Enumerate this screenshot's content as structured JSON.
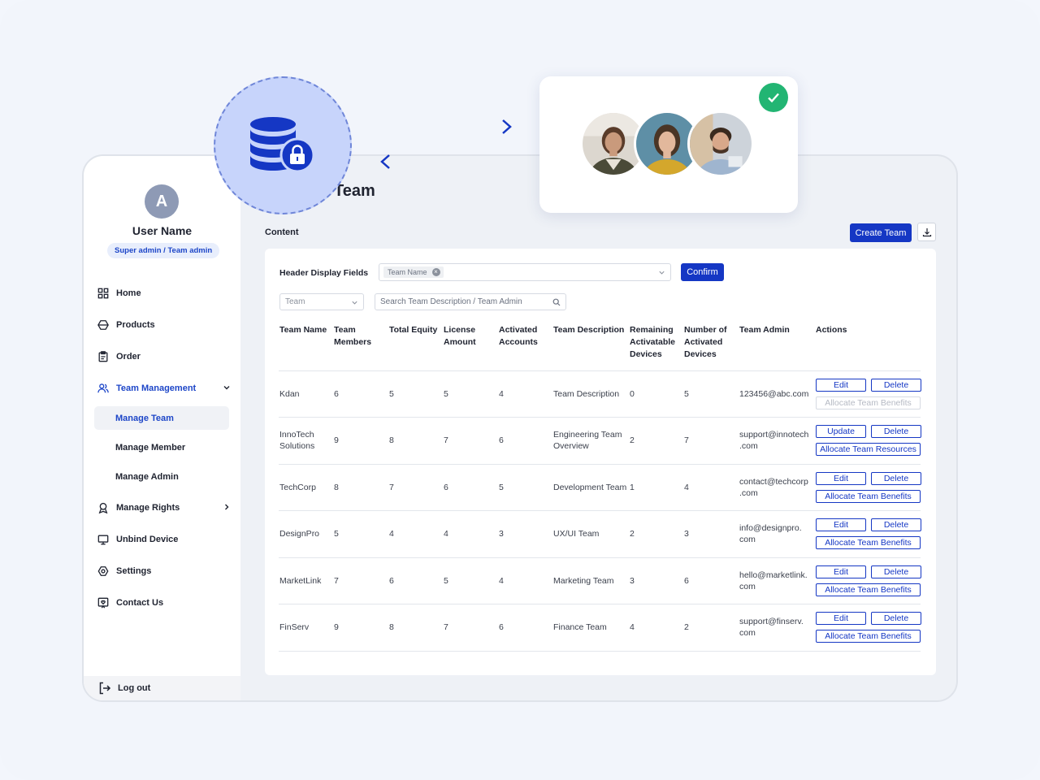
{
  "user": {
    "initial": "A",
    "name": "User Name",
    "role": "Super admin / Team admin"
  },
  "nav": {
    "home": "Home",
    "products": "Products",
    "order": "Order",
    "team_management": "Team Management",
    "manage_team": "Manage Team",
    "manage_member": "Manage Member",
    "manage_admin": "Manage Admin",
    "manage_rights": "Manage Rights",
    "unbind_device": "Unbind Device",
    "settings": "Settings",
    "contact_us": "Contact Us",
    "logout": "Log out"
  },
  "page": {
    "title": "Team",
    "section": "Content",
    "create_button": "Create Team"
  },
  "filters": {
    "header_display_label": "Header Display Fields",
    "selected_tag": "Team Name",
    "confirm": "Confirm",
    "team_select_value": "Team",
    "search_placeholder": "Search Team Description / Team Admin"
  },
  "table": {
    "headers": {
      "name": "Team Name",
      "members": "Team Members",
      "equity": "Total Equity",
      "license": "License Amount",
      "activated": "Activated Accounts",
      "desc": "Team Description",
      "remaining": "Remaining Activatable Devices",
      "num_activated": "Number of Activated Devices",
      "admin": "Team Admin",
      "actions": "Actions"
    },
    "rows": [
      {
        "name": "Kdan",
        "members": "6",
        "equity": "5",
        "license": "5",
        "activated": "4",
        "desc": "Team Description",
        "remaining": "0",
        "num_activated": "5",
        "admin": "123456@abc.com",
        "btn1": "Edit",
        "btn2": "Delete",
        "btn3": "Allocate Team Benefits"
      },
      {
        "name": "InnoTech Solutions",
        "members": "9",
        "equity": "8",
        "license": "7",
        "activated": "6",
        "desc": "Engineering Team Overview",
        "remaining": "2",
        "num_activated": "7",
        "admin": "support@innotech .com",
        "btn1": "Update",
        "btn2": "Delete",
        "btn3": "Allocate Team Resources"
      },
      {
        "name": "TechCorp",
        "members": "8",
        "equity": "7",
        "license": "6",
        "activated": "5",
        "desc": "Development Team",
        "remaining": "1",
        "num_activated": "4",
        "admin": "contact@techcorp .com",
        "btn1": "Edit",
        "btn2": "Delete",
        "btn3": "Allocate Team Benefits"
      },
      {
        "name": "DesignPro",
        "members": "5",
        "equity": "4",
        "license": "4",
        "activated": "3",
        "desc": "UX/UI Team",
        "remaining": "2",
        "num_activated": "3",
        "admin": "info@designpro. com",
        "btn1": "Edit",
        "btn2": "Delete",
        "btn3": "Allocate Team Benefits"
      },
      {
        "name": "MarketLink",
        "members": "7",
        "equity": "6",
        "license": "5",
        "activated": "4",
        "desc": "Marketing Team",
        "remaining": "3",
        "num_activated": "6",
        "admin": "hello@marketlink. com",
        "btn1": "Edit",
        "btn2": "Delete",
        "btn3": "Allocate Team Benefits"
      },
      {
        "name": "FinServ",
        "members": "9",
        "equity": "8",
        "license": "7",
        "activated": "6",
        "desc": "Finance Team",
        "remaining": "4",
        "num_activated": "2",
        "admin": "support@finserv. com",
        "btn1": "Edit",
        "btn2": "Delete",
        "btn3": "Allocate Team Benefits"
      }
    ]
  },
  "colors": {
    "primary": "#1537c4",
    "accent_light": "#c7d4fb",
    "success": "#22b573"
  }
}
